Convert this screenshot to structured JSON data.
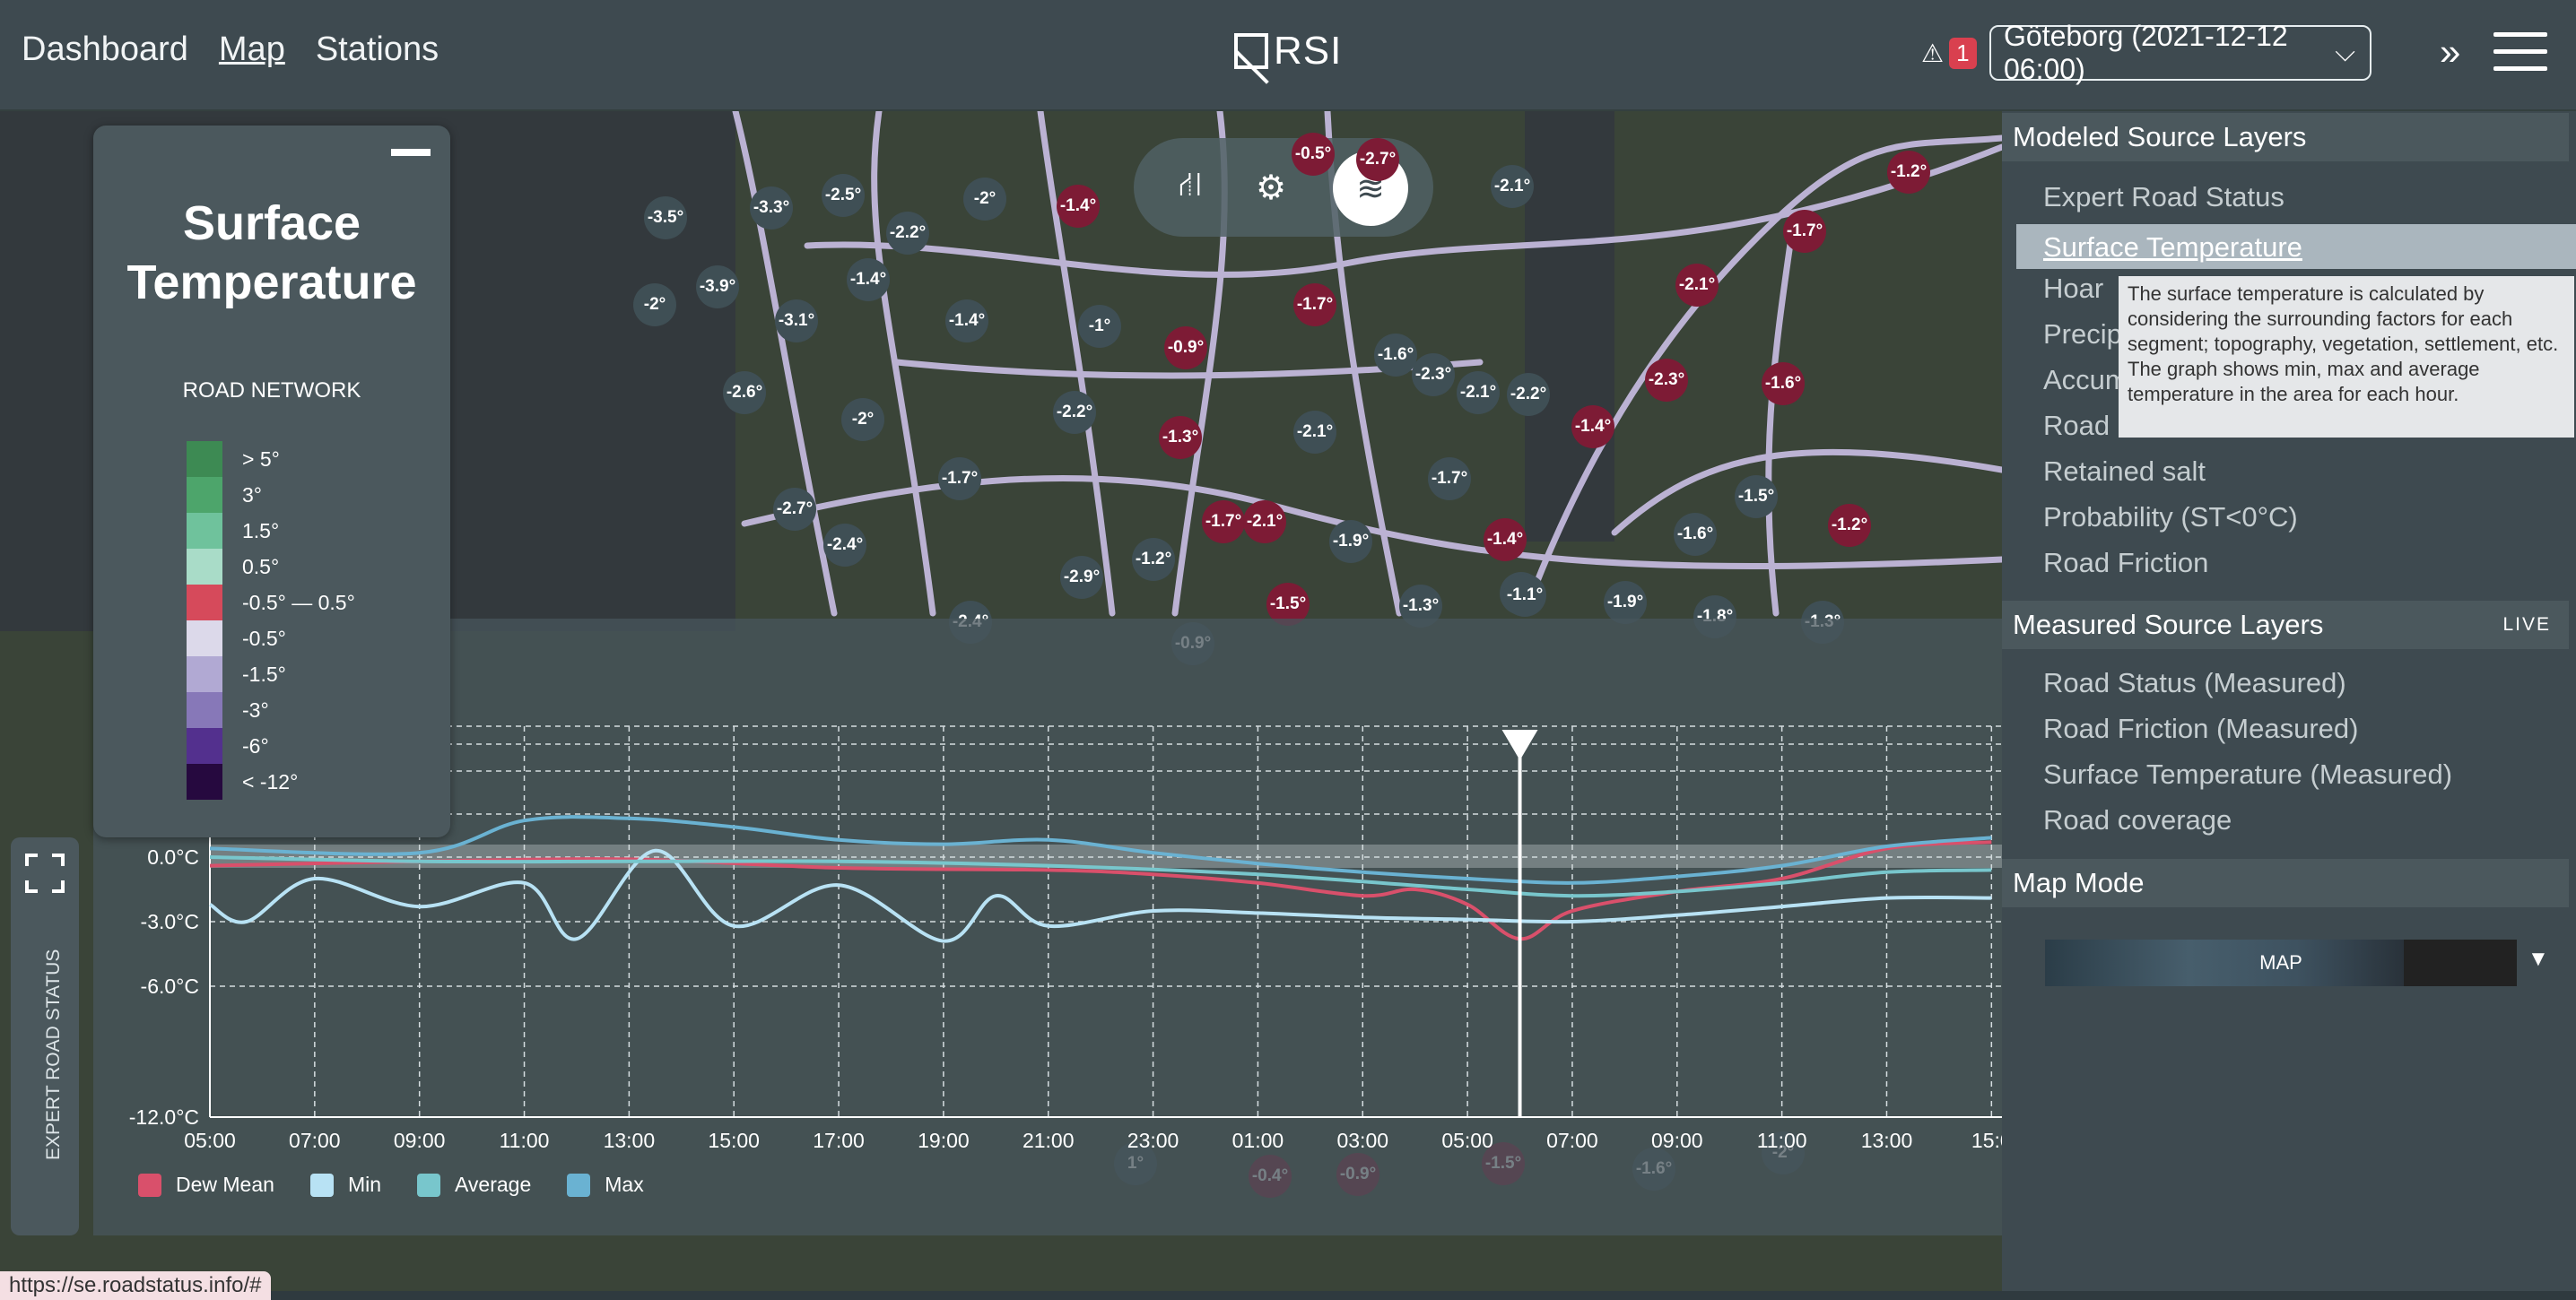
{
  "nav": {
    "dashboard": "Dashboard",
    "map": "Map",
    "stations": "Stations"
  },
  "logo": "RSI",
  "alert": {
    "icon": "warning-icon",
    "count": "1"
  },
  "location_select": {
    "value": "Göteborg (2021-12-12 06:00)"
  },
  "legend": {
    "title_line1": "Surface",
    "title_line2": "Temperature",
    "subtitle": "ROAD NETWORK",
    "items": [
      {
        "label": "> 5°",
        "color": "#3d8a53"
      },
      {
        "label": "3°",
        "color": "#4da56b"
      },
      {
        "label": "1.5°",
        "color": "#6fc29c"
      },
      {
        "label": "0.5°",
        "color": "#a9dcc8"
      },
      {
        "label": "-0.5° — 0.5°",
        "color": "#d64a5b"
      },
      {
        "label": "-0.5°",
        "color": "#dcd9ea"
      },
      {
        "label": "-1.5°",
        "color": "#b1a9d3"
      },
      {
        "label": "-3°",
        "color": "#8778b8"
      },
      {
        "label": "-6°",
        "color": "#53308e"
      },
      {
        "label": "< -12°",
        "color": "#26093f"
      }
    ]
  },
  "markers": [
    {
      "v": "-3.5°",
      "c": "grey"
    },
    {
      "v": "-3.3°",
      "c": "grey"
    },
    {
      "v": "-2.5°",
      "c": "grey"
    },
    {
      "v": "-2°",
      "c": "grey"
    },
    {
      "v": "-1.4°",
      "c": "red"
    },
    {
      "v": "-2.2°",
      "c": "grey"
    },
    {
      "v": "-2°",
      "c": "grey"
    },
    {
      "v": "-3.9°",
      "c": "grey"
    },
    {
      "v": "-3.1°",
      "c": "grey"
    },
    {
      "v": "-1.4°",
      "c": "grey"
    },
    {
      "v": "-1.4°",
      "c": "grey"
    },
    {
      "v": "-1°",
      "c": "grey"
    },
    {
      "v": "-0.9°",
      "c": "red"
    },
    {
      "v": "-1.7°",
      "c": "red"
    },
    {
      "v": "-1.6°",
      "c": "grey"
    },
    {
      "v": "-2.3°",
      "c": "grey"
    },
    {
      "v": "-2.1°",
      "c": "grey"
    },
    {
      "v": "-2.2°",
      "c": "grey"
    },
    {
      "v": "-2.6°",
      "c": "grey"
    },
    {
      "v": "-2°",
      "c": "grey"
    },
    {
      "v": "-2.2°",
      "c": "grey"
    },
    {
      "v": "-1.3°",
      "c": "red"
    },
    {
      "v": "-2.1°",
      "c": "grey"
    },
    {
      "v": "-1.7°",
      "c": "grey"
    },
    {
      "v": "-1.7°",
      "c": "grey"
    },
    {
      "v": "-2.7°",
      "c": "grey"
    },
    {
      "v": "-2.4°",
      "c": "grey"
    },
    {
      "v": "-1.7°",
      "c": "red"
    },
    {
      "v": "-2.1°",
      "c": "red"
    },
    {
      "v": "-1.9°",
      "c": "grey"
    },
    {
      "v": "-1.4°",
      "c": "red"
    },
    {
      "v": "-1.9°",
      "c": "grey"
    },
    {
      "v": "-2.9°",
      "c": "grey"
    },
    {
      "v": "-1.2°",
      "c": "grey"
    },
    {
      "v": "-2.4°",
      "c": "grey"
    },
    {
      "v": "-1.5°",
      "c": "red"
    },
    {
      "v": "-1.3°",
      "c": "grey"
    },
    {
      "v": "-1.1°",
      "c": "grey"
    },
    {
      "v": "-1.9°",
      "c": "grey"
    },
    {
      "v": "-0.9°",
      "c": "grey"
    },
    {
      "v": "-2.1°",
      "c": "red"
    },
    {
      "v": "-1.7°",
      "c": "red"
    },
    {
      "v": "-1.2°",
      "c": "red"
    },
    {
      "v": "-2.1°",
      "c": "grey"
    },
    {
      "v": "-2.3°",
      "c": "red"
    },
    {
      "v": "-1.6°",
      "c": "red"
    },
    {
      "v": "-1.4°",
      "c": "red"
    },
    {
      "v": "-1.5°",
      "c": "grey"
    },
    {
      "v": "-1.2°",
      "c": "red"
    },
    {
      "v": "-1.6°",
      "c": "grey"
    },
    {
      "v": "-1.8°",
      "c": "grey"
    },
    {
      "v": "-1.3°",
      "c": "grey"
    },
    {
      "v": "-2.7°",
      "c": "red"
    },
    {
      "v": "-0.5°",
      "c": "red"
    },
    {
      "v": "1°",
      "c": "grey"
    },
    {
      "v": "-0.4°",
      "c": "red"
    },
    {
      "v": "-0.9°",
      "c": "red"
    },
    {
      "v": "-1.5°",
      "c": "red"
    },
    {
      "v": "-1.6°",
      "c": "grey"
    },
    {
      "v": "-2°",
      "c": "grey"
    }
  ],
  "chart_data": {
    "type": "line",
    "x_ticks": [
      "05:00",
      "07:00",
      "09:00",
      "11:00",
      "13:00",
      "15:00",
      "17:00",
      "19:00",
      "21:00",
      "23:00",
      "01:00",
      "03:00",
      "05:00",
      "07:00",
      "09:00",
      "11:00",
      "13:00",
      "15:0"
    ],
    "y_ticks": [
      "0.0°C",
      "-3.0°C",
      "-6.0°C",
      "-12.0°C"
    ],
    "y_values": [
      0,
      -3,
      -6,
      -12
    ],
    "x_hours": [
      0,
      2,
      4,
      6,
      8,
      10,
      12,
      14,
      16,
      18,
      20,
      22,
      24,
      26,
      28,
      30,
      32,
      34
    ],
    "current_hour": 25,
    "series": [
      {
        "name": "Dew Mean",
        "color": "#d9506b",
        "values": [
          [
            0,
            -0.4
          ],
          [
            4,
            -0.2
          ],
          [
            8,
            -0.1
          ],
          [
            12,
            -0.5
          ],
          [
            16,
            -0.6
          ],
          [
            18,
            -0.8
          ],
          [
            20,
            -1.2
          ],
          [
            22,
            -1.8
          ],
          [
            23,
            -1.5
          ],
          [
            24,
            -2.2
          ],
          [
            25,
            -3.8
          ],
          [
            26,
            -2.5
          ],
          [
            28,
            -1.6
          ],
          [
            30,
            -1.0
          ],
          [
            32,
            0.4
          ],
          [
            34,
            0.7
          ]
        ]
      },
      {
        "name": "Min",
        "color": "#b8e2f4",
        "values": [
          [
            0,
            -2.2
          ],
          [
            0.7,
            -3.0
          ],
          [
            2,
            -1.0
          ],
          [
            4,
            -2.3
          ],
          [
            6,
            -1.2
          ],
          [
            7,
            -3.8
          ],
          [
            8.5,
            0.3
          ],
          [
            10,
            -3.2
          ],
          [
            12,
            -1.3
          ],
          [
            14,
            -3.9
          ],
          [
            15,
            -1.8
          ],
          [
            16,
            -3.2
          ],
          [
            18,
            -2.5
          ],
          [
            20,
            -2.6
          ],
          [
            22,
            -2.8
          ],
          [
            24,
            -2.9
          ],
          [
            26,
            -3.0
          ],
          [
            28,
            -2.7
          ],
          [
            30,
            -2.3
          ],
          [
            32,
            -1.9
          ],
          [
            34,
            -1.9
          ]
        ]
      },
      {
        "name": "Average",
        "color": "#78c6cc",
        "values": [
          [
            0,
            0
          ],
          [
            4,
            -0.2
          ],
          [
            8,
            -0.2
          ],
          [
            12,
            -0.2
          ],
          [
            16,
            -0.4
          ],
          [
            20,
            -0.8
          ],
          [
            24,
            -1.5
          ],
          [
            26,
            -1.8
          ],
          [
            28,
            -1.6
          ],
          [
            30,
            -1.2
          ],
          [
            32,
            -0.7
          ],
          [
            34,
            -0.6
          ]
        ]
      },
      {
        "name": "Max",
        "color": "#6ab2d2",
        "values": [
          [
            0,
            0.4
          ],
          [
            4,
            0.2
          ],
          [
            6,
            1.7
          ],
          [
            8,
            1.8
          ],
          [
            10,
            1.4
          ],
          [
            12,
            0.8
          ],
          [
            14,
            0.6
          ],
          [
            16,
            0.8
          ],
          [
            18,
            0.2
          ],
          [
            20,
            -0.3
          ],
          [
            22,
            -0.7
          ],
          [
            24,
            -1.0
          ],
          [
            26,
            -1.2
          ],
          [
            28,
            -0.9
          ],
          [
            30,
            -0.4
          ],
          [
            32,
            0.5
          ],
          [
            34,
            0.9
          ]
        ]
      }
    ]
  },
  "side": {
    "vertical_label": "EXPERT ROAD STATUS"
  },
  "url": "https://se.roadstatus.info/#",
  "panel": {
    "modeled_title": "Modeled Source Layers",
    "modeled": [
      "Expert Road Status",
      "Surface Temperature",
      "Hoar",
      "Precip",
      "Accum",
      "Road",
      "Retained salt",
      "Probability (ST<0°C)",
      "Road Friction"
    ],
    "measured_title": "Measured Source Layers",
    "live": "LIVE",
    "measured": [
      "Road Status (Measured)",
      "Road Friction (Measured)",
      "Surface Temperature (Measured)",
      "Road coverage"
    ],
    "mapmode_title": "Map Mode",
    "mapmode_value": "MAP"
  },
  "tooltip": "The surface temperature is calculated by considering the surrounding factors for each segment; topography, vegetation, settlement, etc. The graph shows min, max and average temperature in the area for each hour."
}
